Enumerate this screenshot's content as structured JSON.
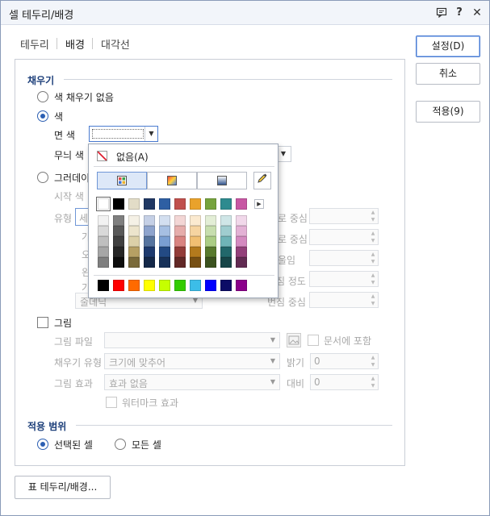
{
  "window": {
    "title": "셀 테두리/배경"
  },
  "title_icons": [
    "chat-icon",
    "help-icon",
    "close-icon"
  ],
  "tabs": [
    {
      "label": "테두리",
      "active": false
    },
    {
      "label": "배경",
      "active": true
    },
    {
      "label": "대각선",
      "active": false
    }
  ],
  "fill": {
    "section_title": "채우기",
    "no_fill_label": "색 채우기 없음",
    "color_label": "색",
    "face_color_label": "면 색",
    "pattern_color_label": "무늬 색",
    "gradient_label": "그러데이",
    "start_color_label": "시작 색",
    "type_label": "유형",
    "type_value": "세",
    "gradient_options": [
      "가",
      "오",
      "왼",
      "가"
    ],
    "gradient_last_value": "줄데닉",
    "right_labels": [
      "로 중심",
      "로 중심",
      "울임",
      "번짐 정도",
      "번짐 중심"
    ]
  },
  "image": {
    "label": "그림",
    "file_label": "그림 파일",
    "fill_type_label": "채우기 유형",
    "fill_type_value": "크기에 맞추어",
    "effect_label": "그림 효과",
    "effect_value": "효과 없음",
    "include_in_doc_label": "문서에 포함",
    "brightness_label": "밝기",
    "brightness_value": "0",
    "contrast_label": "대비",
    "contrast_value": "0",
    "watermark_label": "워터마크 효과"
  },
  "scope": {
    "section_title": "적용 범위",
    "selected_label": "선택된 셀",
    "all_label": "모든 셀"
  },
  "buttons": {
    "ok": "설정(D)",
    "cancel": "취소",
    "apply": "적용(9)",
    "table_border": "표 테두리/배경..."
  },
  "color_popup": {
    "none_label": "없음(A)",
    "top_row": [
      "#ffffff",
      "#000000",
      "#e2dcc7",
      "#203864",
      "#2e5fa3",
      "#c0504d",
      "#e9a22b",
      "#76a33d",
      "#2e8b8f",
      "#c757a3"
    ],
    "shade_columns": [
      [
        "#f2f2f2",
        "#d9d9d9",
        "#bfbfbf",
        "#a6a6a6",
        "#7f7f7f"
      ],
      [
        "#7f7f7f",
        "#595959",
        "#404040",
        "#262626",
        "#0d0d0d"
      ],
      [
        "#f5f1e6",
        "#ece4cc",
        "#dcd0a8",
        "#b6a064",
        "#7a6a3a"
      ],
      [
        "#c5d0e6",
        "#8ea4cd",
        "#56749f",
        "#1e3a6e",
        "#142848"
      ],
      [
        "#d3dff0",
        "#a6bfe2",
        "#7a9fd2",
        "#234a84",
        "#173159"
      ],
      [
        "#f3d6d5",
        "#e6adab",
        "#d98481",
        "#933c39",
        "#622826"
      ],
      [
        "#fbead0",
        "#f6d4a1",
        "#f1bf72",
        "#b37a1d",
        "#774f13"
      ],
      [
        "#e3eed6",
        "#c7deae",
        "#abcd85",
        "#587a2e",
        "#3b521f"
      ],
      [
        "#cfe6e7",
        "#9fcdcf",
        "#6fb4b7",
        "#22686b",
        "#174648"
      ],
      [
        "#f1d8ea",
        "#e3b1d5",
        "#d48ac0",
        "#93407a",
        "#622b52"
      ]
    ],
    "standard_row": [
      "#000000",
      "#ff0000",
      "#ff6a00",
      "#ffff00",
      "#c6ff00",
      "#33cc00",
      "#3cbde8",
      "#0000ff",
      "#0c0c66",
      "#8a008a"
    ]
  }
}
